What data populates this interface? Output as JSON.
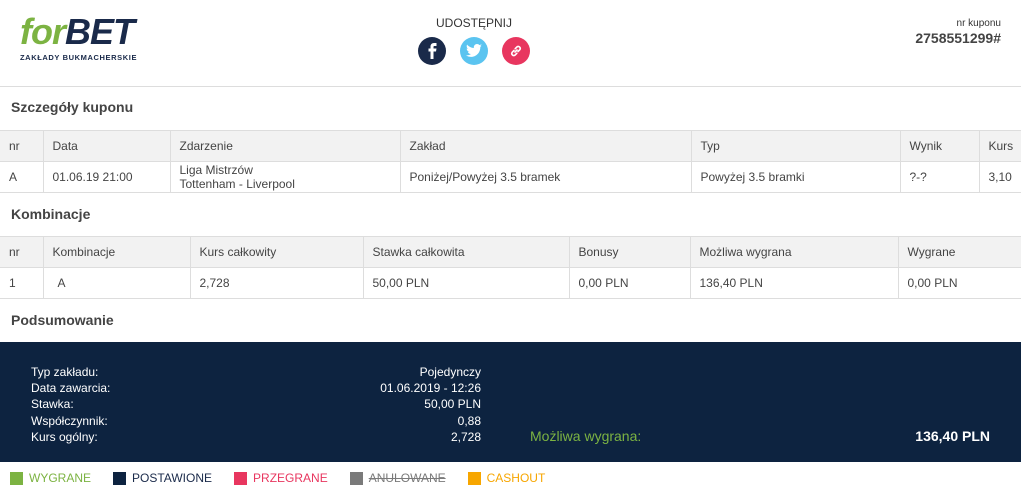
{
  "brand": {
    "logo_for": "for",
    "logo_bet": "BET",
    "logo_sub": "ZAKŁADY BUKMACHERSKIE"
  },
  "share": {
    "label": "UDOSTĘPNIJ"
  },
  "coupon": {
    "label": "nr kuponu",
    "number": "2758551299#"
  },
  "details": {
    "title": "Szczegóły kuponu",
    "headers": [
      "nr",
      "Data",
      "Zdarzenie",
      "Zakład",
      "Typ",
      "Wynik",
      "Kurs"
    ],
    "rows": [
      {
        "nr": "A",
        "date": "01.06.19 21:00",
        "event_league": "Liga Mistrzów",
        "event_match": "Tottenham - Liverpool",
        "bet": "Poniżej/Powyżej 3.5 bramek",
        "type": "Powyżej 3.5 bramki",
        "result": "?-?",
        "odds": "3,10"
      }
    ]
  },
  "combinations": {
    "title": "Kombinacje",
    "headers": [
      "nr",
      "Kombinacje",
      "Kurs całkowity",
      "Stawka całkowita",
      "Bonusy",
      "Możliwa wygrana",
      "Wygrane"
    ],
    "rows": [
      {
        "nr": "1",
        "combination": "A",
        "total_odds": "2,728",
        "total_stake": "50,00 PLN",
        "bonus": "0,00 PLN",
        "potential_win": "136,40 PLN",
        "winnings": "0,00 PLN"
      }
    ]
  },
  "summary": {
    "title": "Podsumowanie",
    "items": [
      {
        "label": "Typ zakładu:",
        "value": "Pojedynczy"
      },
      {
        "label": "Data zawarcia:",
        "value": "01.06.2019 - 12:26"
      },
      {
        "label": "Stawka:",
        "value": "50,00 PLN"
      },
      {
        "label": "Współczynnik:",
        "value": "0,88"
      },
      {
        "label": "Kurs ogólny:",
        "value": "2,728"
      }
    ],
    "potential_label": "Możliwa wygrana:",
    "potential_value": "136,40 PLN"
  },
  "legend": [
    {
      "label": "WYGRANE",
      "color": "#7cb342",
      "text_color": "#7cb342"
    },
    {
      "label": "POSTAWIONE",
      "color": "#0d2340",
      "text_color": "#1a2a4a"
    },
    {
      "label": "PRZEGRANE",
      "color": "#e8365f",
      "text_color": "#e8365f"
    },
    {
      "label": "ANULOWANE",
      "color": "#7a7a7a",
      "text_color": "#7a7a7a"
    },
    {
      "label": "CASHOUT",
      "color": "#f7a600",
      "text_color": "#f7a600"
    }
  ]
}
